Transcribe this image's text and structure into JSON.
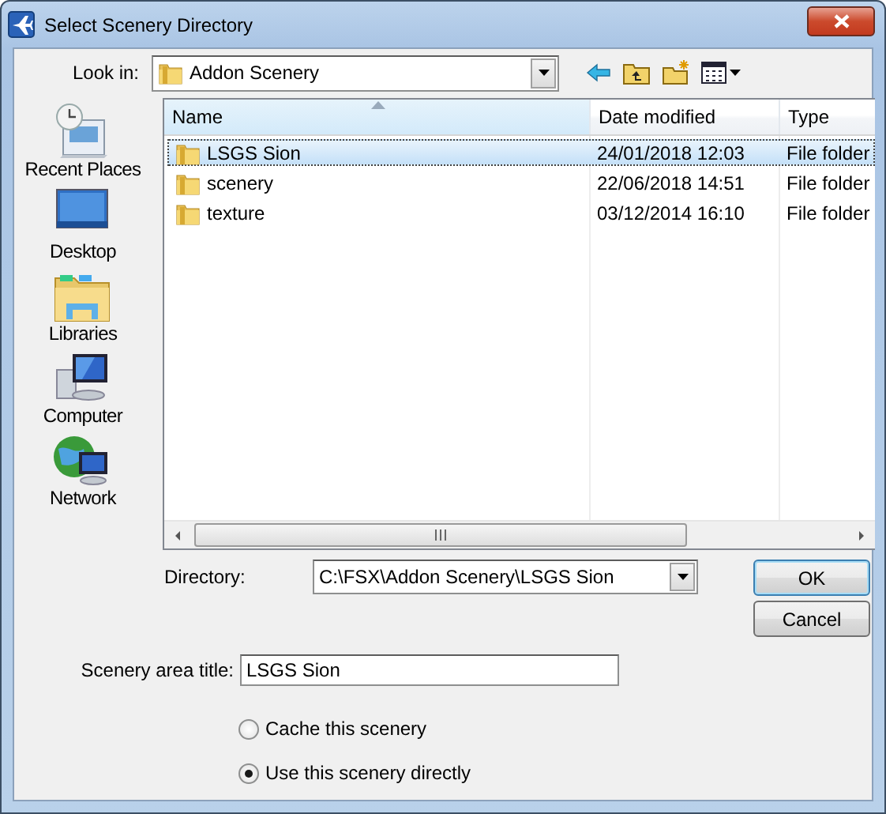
{
  "window": {
    "title": "Select Scenery Directory"
  },
  "look_in": {
    "label": "Look in:",
    "value": "Addon Scenery"
  },
  "places": [
    {
      "label": "Recent Places",
      "kind": "recent"
    },
    {
      "label": "Desktop",
      "kind": "desktop"
    },
    {
      "label": "Libraries",
      "kind": "libraries"
    },
    {
      "label": "Computer",
      "kind": "computer"
    },
    {
      "label": "Network",
      "kind": "network"
    }
  ],
  "file_list": {
    "columns": [
      {
        "label": "Name",
        "sorted": true
      },
      {
        "label": "Date modified",
        "sorted": false
      },
      {
        "label": "Type",
        "sorted": false
      }
    ],
    "rows": [
      {
        "name": "LSGS Sion",
        "date": "24/01/2018 12:03",
        "type": "File folder",
        "selected": true
      },
      {
        "name": "scenery",
        "date": "22/06/2018 14:51",
        "type": "File folder",
        "selected": false
      },
      {
        "name": "texture",
        "date": "03/12/2014 16:10",
        "type": "File folder",
        "selected": false
      }
    ]
  },
  "directory": {
    "label": "Directory:",
    "value": "C:\\FSX\\Addon Scenery\\LSGS Sion"
  },
  "buttons": [
    {
      "label": "OK",
      "default": true
    },
    {
      "label": "Cancel",
      "default": false
    }
  ],
  "title_field": {
    "label": "Scenery area title:",
    "value": "LSGS Sion"
  },
  "options": [
    {
      "label": "Cache this scenery",
      "selected": false
    },
    {
      "label": "Use this scenery directly",
      "selected": true
    }
  ]
}
